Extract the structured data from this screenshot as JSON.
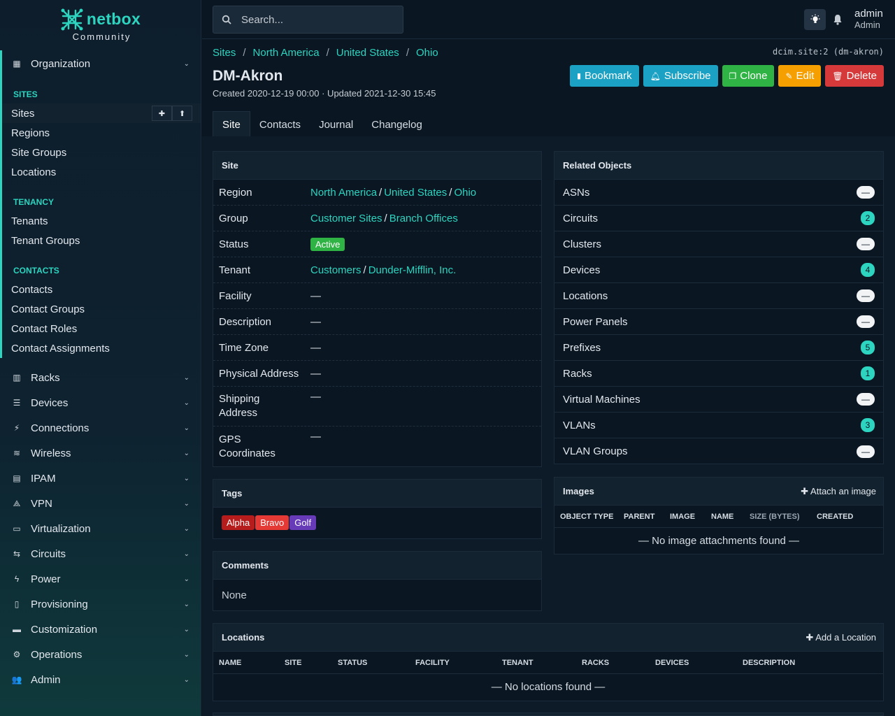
{
  "brand": {
    "name": "netbox",
    "edition": "Community"
  },
  "search": {
    "placeholder": "Search..."
  },
  "user": {
    "name": "admin",
    "role": "Admin"
  },
  "nav": {
    "organization": "Organization",
    "sections": [
      {
        "title": "SITES",
        "items": [
          "Sites",
          "Regions",
          "Site Groups",
          "Locations"
        ]
      },
      {
        "title": "TENANCY",
        "items": [
          "Tenants",
          "Tenant Groups"
        ]
      },
      {
        "title": "CONTACTS",
        "items": [
          "Contacts",
          "Contact Groups",
          "Contact Roles",
          "Contact Assignments"
        ]
      }
    ],
    "menus": [
      "Racks",
      "Devices",
      "Connections",
      "Wireless",
      "IPAM",
      "VPN",
      "Virtualization",
      "Circuits",
      "Power",
      "Provisioning",
      "Customization",
      "Operations",
      "Admin"
    ]
  },
  "breadcrumb": [
    "Sites",
    "North America",
    "United States",
    "Ohio"
  ],
  "object_id": "dcim.site:2 (dm-akron)",
  "title": "DM-Akron",
  "meta": "Created 2020-12-19 00:00 · Updated 2021-12-30 15:45",
  "actions": {
    "bookmark": "Bookmark",
    "subscribe": "Subscribe",
    "clone": "Clone",
    "edit": "Edit",
    "delete": "Delete"
  },
  "tabs": [
    "Site",
    "Contacts",
    "Journal",
    "Changelog"
  ],
  "site_card": {
    "title": "Site",
    "region": [
      "North America",
      "United States",
      "Ohio"
    ],
    "group": [
      "Customer Sites",
      "Branch Offices"
    ],
    "status": "Active",
    "tenant": [
      "Customers",
      "Dunder-Mifflin, Inc."
    ],
    "labels": {
      "region": "Region",
      "group": "Group",
      "status": "Status",
      "tenant": "Tenant",
      "facility": "Facility",
      "description": "Description",
      "time_zone": "Time Zone",
      "physical_address": "Physical Address",
      "shipping_address": "Shipping Address",
      "gps": "GPS Coordinates"
    },
    "dash": "—"
  },
  "related": {
    "title": "Related Objects",
    "items": [
      {
        "label": "ASNs",
        "count": "—"
      },
      {
        "label": "Circuits",
        "count": "2"
      },
      {
        "label": "Clusters",
        "count": "—"
      },
      {
        "label": "Devices",
        "count": "4"
      },
      {
        "label": "Locations",
        "count": "—"
      },
      {
        "label": "Power Panels",
        "count": "—"
      },
      {
        "label": "Prefixes",
        "count": "5"
      },
      {
        "label": "Racks",
        "count": "1"
      },
      {
        "label": "Virtual Machines",
        "count": "—"
      },
      {
        "label": "VLANs",
        "count": "3"
      },
      {
        "label": "VLAN Groups",
        "count": "—"
      }
    ]
  },
  "tags": {
    "title": "Tags",
    "items": [
      {
        "name": "Alpha",
        "color": "#b71c1c"
      },
      {
        "name": "Bravo",
        "color": "#e53935"
      },
      {
        "name": "Golf",
        "color": "#673ab7"
      }
    ]
  },
  "comments": {
    "title": "Comments",
    "body": "None"
  },
  "images": {
    "title": "Images",
    "action": "Attach an image",
    "columns": [
      "OBJECT TYPE",
      "PARENT",
      "IMAGE",
      "NAME",
      "SIZE (BYTES)",
      "CREATED"
    ],
    "empty": "— No image attachments found —"
  },
  "locations": {
    "title": "Locations",
    "action": "Add a Location",
    "columns": [
      "NAME",
      "SITE",
      "STATUS",
      "FACILITY",
      "TENANT",
      "RACKS",
      "DEVICES",
      "DESCRIPTION"
    ],
    "empty": "— No locations found —"
  }
}
